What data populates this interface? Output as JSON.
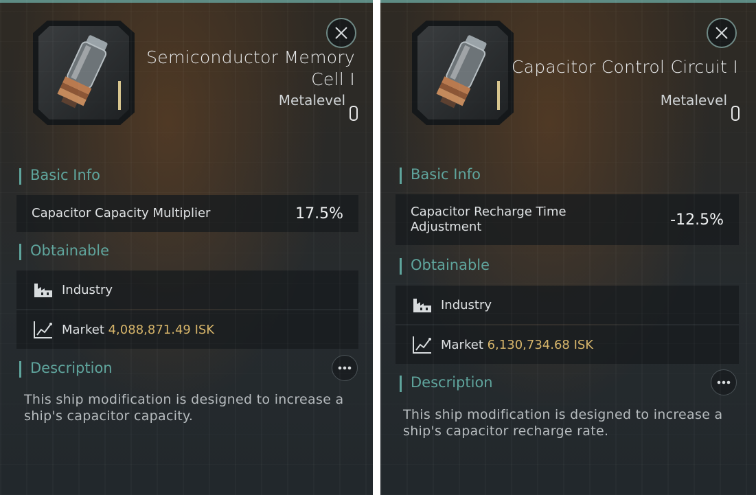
{
  "left": {
    "title_line1": "Semiconductor Memory",
    "title_line2": "Cell I",
    "metalevel_label": "Metalevel",
    "metalevel_value": "0",
    "basic_info_header": "Basic Info",
    "stat_label": "Capacitor Capacity Multiplier",
    "stat_value": "17.5%",
    "obtainable_header": "Obtainable",
    "industry_label": "Industry",
    "market_label": "Market",
    "market_price": "4,088,871.49 ISK",
    "description_header": "Description",
    "description_line1": "This ship modification is designed to increase a",
    "description_line2": "ship's capacitor capacity."
  },
  "right": {
    "title": "Capacitor Control Circuit I",
    "metalevel_label": "Metalevel",
    "metalevel_value": "0",
    "basic_info_header": "Basic Info",
    "stat_label_line1": "Capacitor Recharge Time",
    "stat_label_line2": "Adjustment",
    "stat_value": "-12.5%",
    "obtainable_header": "Obtainable",
    "industry_label": "Industry",
    "market_label": "Market",
    "market_price": "6,130,734.68 ISK",
    "description_header": "Description",
    "description_line1": "This ship modification is designed to increase a",
    "description_line2": "ship's capacitor recharge rate."
  },
  "icons": {
    "close": "close-icon",
    "item": "capacitor-module-icon",
    "industry": "factory-icon",
    "market": "market-chart-icon",
    "more": "more-options-icon"
  },
  "colors": {
    "accent": "#5fa59d",
    "price": "#d7b56a",
    "tier_bar": "#d8c68f"
  }
}
